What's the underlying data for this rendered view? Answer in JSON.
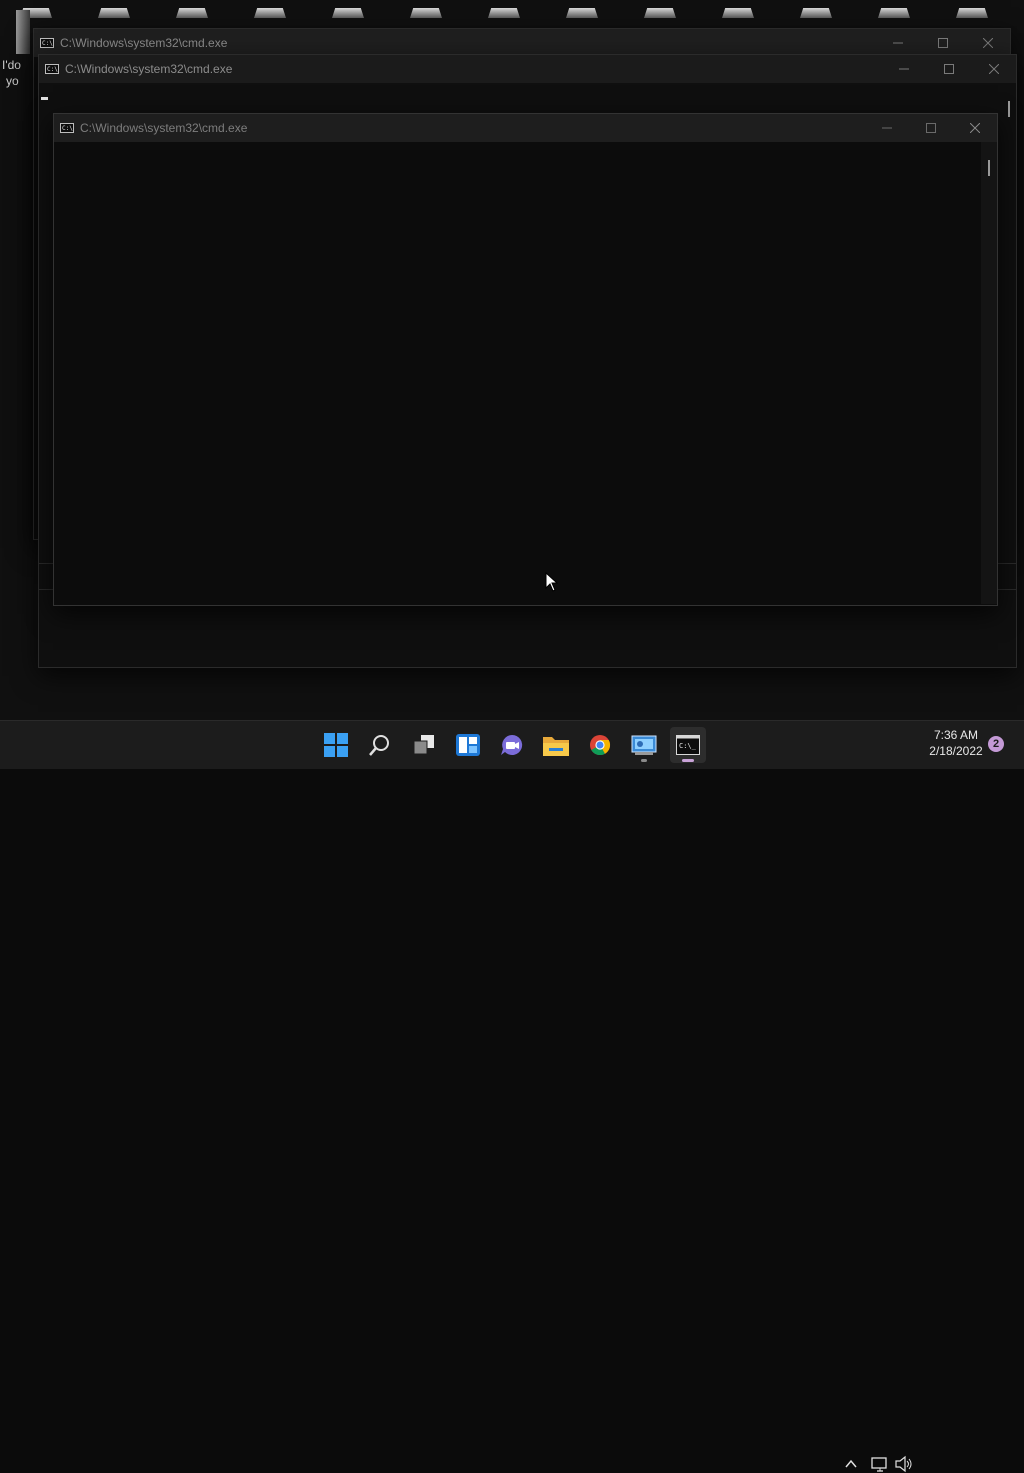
{
  "desktop": {
    "left_fragments": [
      "I'do",
      "yo"
    ]
  },
  "windows": [
    {
      "title": "C:\\Windows\\system32\\cmd.exe"
    },
    {
      "title": "C:\\Windows\\system32\\cmd.exe"
    },
    {
      "title": "C:\\Windows\\system32\\cmd.exe"
    }
  ],
  "taskbar": {
    "apps": [
      "start",
      "search",
      "task-view",
      "widgets",
      "teams-chat",
      "file-explorer",
      "chrome",
      "control-panel",
      "command-prompt"
    ],
    "clock_time": "7:36 AM",
    "clock_date": "2/18/2022",
    "notification_count": "2"
  },
  "colors": {
    "window_bg": "#0c0c0c",
    "titlebar_bg": "#1f1f1f",
    "taskbar_bg": "#1c1c1c",
    "accent": "#c49ad6",
    "windows_blue": "#1e90ff"
  }
}
